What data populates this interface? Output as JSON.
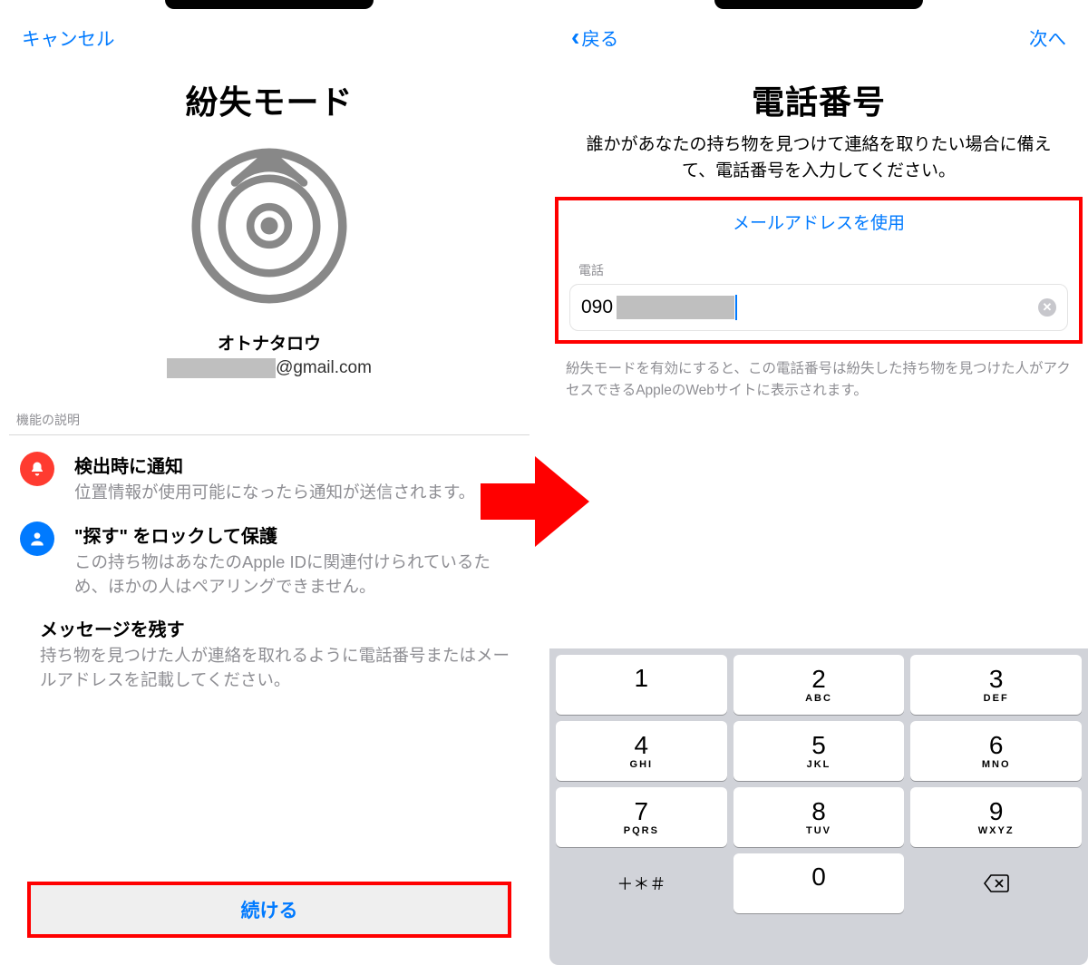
{
  "left": {
    "cancel": "キャンセル",
    "title": "紛失モード",
    "account_name": "オトナタロウ",
    "account_email_suffix": "@gmail.com",
    "section_label": "機能の説明",
    "features": [
      {
        "title": "検出時に通知",
        "desc": "位置情報が使用可能になったら通知が送信されます。"
      },
      {
        "title": "\"探す\" をロックして保護",
        "desc": "この持ち物はあなたのApple IDに関連付けられているため、ほかの人はペアリングできません。"
      },
      {
        "title": "メッセージを残す",
        "desc": "持ち物を見つけた人が連絡を取れるように電話番号またはメールアドレスを記載してください。"
      }
    ],
    "continue": "続ける"
  },
  "right": {
    "back": "戻る",
    "next": "次へ",
    "title": "電話番号",
    "subtitle": "誰かがあなたの持ち物を見つけて連絡を取りたい場合に備えて、電話番号を入力してください。",
    "use_email": "メールアドレスを使用",
    "input_label": "電話",
    "input_value": "090",
    "note": "紛失モードを有効にすると、この電話番号は紛失した持ち物を見つけた人がアクセスできるAppleのWebサイトに表示されます。",
    "keypad": {
      "fn_label": "＋＊＃",
      "keys": [
        [
          {
            "n": "1",
            "s": ""
          },
          {
            "n": "2",
            "s": "ABC"
          },
          {
            "n": "3",
            "s": "DEF"
          }
        ],
        [
          {
            "n": "4",
            "s": "GHI"
          },
          {
            "n": "5",
            "s": "JKL"
          },
          {
            "n": "6",
            "s": "MNO"
          }
        ],
        [
          {
            "n": "7",
            "s": "PQRS"
          },
          {
            "n": "8",
            "s": "TUV"
          },
          {
            "n": "9",
            "s": "WXYZ"
          }
        ]
      ],
      "zero": "0"
    }
  }
}
